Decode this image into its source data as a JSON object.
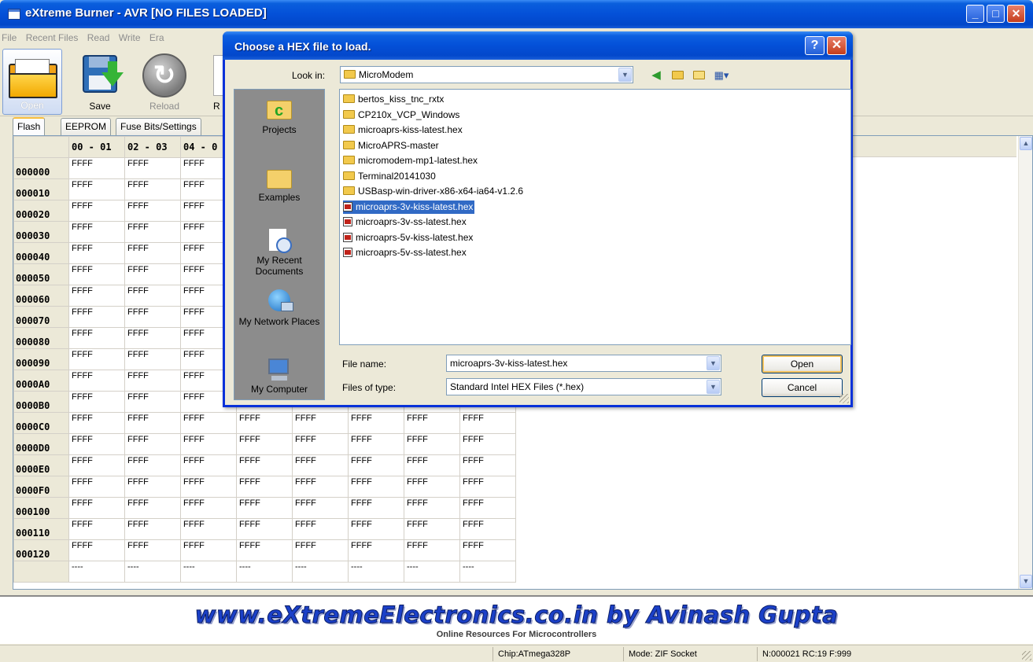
{
  "main_window": {
    "title": "eXtreme Burner - AVR [NO FILES LOADED]",
    "menu": [
      "File",
      "Recent Files",
      "Read",
      "Write",
      "Era"
    ],
    "toolbar": {
      "open": "Open",
      "save": "Save",
      "reload": "Reload",
      "partial": "R"
    },
    "tabs": [
      "Flash",
      "EEPROM",
      "Fuse Bits/Settings"
    ],
    "grid": {
      "columns": [
        "00 - 01",
        "02 - 03",
        "04 - 0"
      ],
      "rows": [
        "000000",
        "000010",
        "000020",
        "000030",
        "000040",
        "000050",
        "000060",
        "000070",
        "000080",
        "000090",
        "0000A0",
        "0000B0",
        "0000C0",
        "0000D0",
        "0000E0",
        "0000F0",
        "000100",
        "000110",
        "000120"
      ],
      "cell_value": "FFFF",
      "partial_row_value": "----"
    },
    "banner": {
      "site": "www.eXtremeElectronics.co.in by Avinash Gupta",
      "tagline": "Online Resources For Microcontrollers"
    },
    "status": {
      "chip": "Chip:ATmega328P",
      "mode": "Mode: ZIF Socket",
      "counters": "N:000021 RC:19 F:999"
    }
  },
  "dialog": {
    "title": "Choose a HEX file to load.",
    "help_glyph": "?",
    "close_glyph": "✕",
    "look_in_label": "Look in:",
    "look_in_value": "MicroModem",
    "places": [
      "Projects",
      "Examples",
      "My Recent Documents",
      "My Network Places",
      "My Computer"
    ],
    "files": [
      {
        "name": "bertos_kiss_tnc_rxtx",
        "kind": "folder"
      },
      {
        "name": "CP210x_VCP_Windows",
        "kind": "folder"
      },
      {
        "name": "microaprs-kiss-latest.hex",
        "kind": "folder"
      },
      {
        "name": "MicroAPRS-master",
        "kind": "folder"
      },
      {
        "name": "micromodem-mp1-latest.hex",
        "kind": "folder"
      },
      {
        "name": "Terminal20141030",
        "kind": "folder"
      },
      {
        "name": "USBasp-win-driver-x86-x64-ia64-v1.2.6",
        "kind": "folder"
      },
      {
        "name": "microaprs-3v-kiss-latest.hex",
        "kind": "file",
        "selected": true
      },
      {
        "name": "microaprs-3v-ss-latest.hex",
        "kind": "file"
      },
      {
        "name": "microaprs-5v-kiss-latest.hex",
        "kind": "file"
      },
      {
        "name": "microaprs-5v-ss-latest.hex",
        "kind": "file"
      }
    ],
    "file_name_label": "File name:",
    "file_name_value": "microaprs-3v-kiss-latest.hex",
    "files_of_type_label": "Files of type:",
    "files_of_type_value": "Standard Intel HEX Files (*.hex)",
    "open_button": "Open",
    "cancel_button": "Cancel"
  },
  "colors": {
    "title_blue": "#0450d8",
    "selection": "#316ac5",
    "banner_blue": "#1b40c8"
  },
  "icons": [
    "folder-open-icon",
    "save-disk-icon",
    "reload-icon",
    "help-icon",
    "close-icon",
    "back-icon",
    "up-folder-icon",
    "new-folder-icon",
    "views-icon",
    "hex-file-icon"
  ]
}
